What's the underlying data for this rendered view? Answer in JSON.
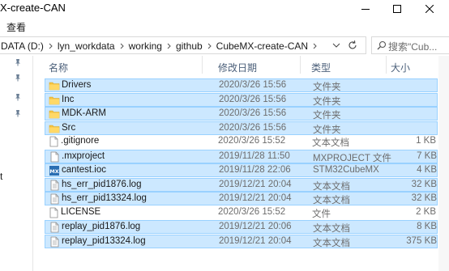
{
  "window": {
    "title": "X-create-CAN"
  },
  "ribbon": {
    "view_tab": "查看"
  },
  "address": {
    "crumbs": [
      "DATA (D:)",
      "lyn_workdata",
      "working",
      "github",
      "CubeMX-create-CAN"
    ]
  },
  "search": {
    "placeholder": "搜索\"Cub..."
  },
  "nav": {
    "stub_label": "t"
  },
  "columns": {
    "name": "名称",
    "date": "修改日期",
    "type": "类型",
    "size": "大小"
  },
  "files": [
    {
      "name": "Drivers",
      "date": "2020/3/26 15:56",
      "type": "文件夹",
      "size": "",
      "icon": "folder-icon",
      "selected": true
    },
    {
      "name": "Inc",
      "date": "2020/3/26 15:56",
      "type": "文件夹",
      "size": "",
      "icon": "folder-icon",
      "selected": true
    },
    {
      "name": "MDK-ARM",
      "date": "2020/3/26 15:56",
      "type": "文件夹",
      "size": "",
      "icon": "folder-icon",
      "selected": true
    },
    {
      "name": "Src",
      "date": "2020/3/26 15:56",
      "type": "文件夹",
      "size": "",
      "icon": "folder-icon",
      "selected": true
    },
    {
      "name": ".gitignore",
      "date": "2020/3/26 15:52",
      "type": "文本文档",
      "size": "1 KB",
      "icon": "file-icon",
      "selected": false
    },
    {
      "name": ".mxproject",
      "date": "2019/11/28 11:50",
      "type": "MXPROJECT 文件",
      "size": "7 KB",
      "icon": "file-icon",
      "selected": true
    },
    {
      "name": "cantest.ioc",
      "date": "2019/11/28 22:06",
      "type": "STM32CubeMX",
      "size": "4 KB",
      "icon": "cubemx-file-icon",
      "selected": true
    },
    {
      "name": "hs_err_pid1876.log",
      "date": "2019/12/21 20:04",
      "type": "文本文档",
      "size": "32 KB",
      "icon": "text-file-icon",
      "selected": true
    },
    {
      "name": "hs_err_pid13324.log",
      "date": "2019/12/21 20:04",
      "type": "文本文档",
      "size": "32 KB",
      "icon": "text-file-icon",
      "selected": true
    },
    {
      "name": "LICENSE",
      "date": "2020/3/26 15:52",
      "type": "文件",
      "size": "2 KB",
      "icon": "file-icon",
      "selected": false
    },
    {
      "name": "replay_pid1876.log",
      "date": "2019/12/21 20:06",
      "type": "文本文档",
      "size": "8 KB",
      "icon": "text-file-icon",
      "selected": true
    },
    {
      "name": "replay_pid13324.log",
      "date": "2019/12/21 20:04",
      "type": "文本文档",
      "size": "375 KB",
      "icon": "text-file-icon",
      "selected": true
    }
  ],
  "colors": {
    "selection_bg": "#cce8ff",
    "selection_border": "#99d1ff",
    "folder": "#f5c342",
    "header_text": "#4c607a"
  }
}
